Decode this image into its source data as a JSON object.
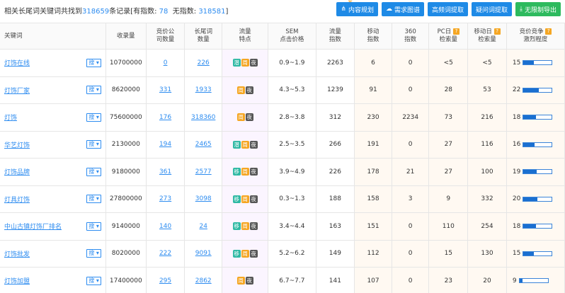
{
  "summary": {
    "prefix": "相关长尾词关键词共找到",
    "total": "318659",
    "suffix": "条记录[有指数:",
    "with_index": "78",
    "no_index_label": "无指数:",
    "no_index": "318581",
    "end": "]"
  },
  "actions": [
    {
      "label": "内容规划",
      "icon": "share-icon"
    },
    {
      "label": "需求图谱",
      "icon": "cloud-icon"
    },
    {
      "label": "高频词提取",
      "icon": ""
    },
    {
      "label": "疑问词提取",
      "icon": ""
    },
    {
      "label": "无限制导出",
      "icon": "download-icon"
    }
  ],
  "headers": {
    "keyword": "关键词",
    "indexed": "收录量",
    "bid_companies_1": "竞价公",
    "bid_companies_2": "司数量",
    "longtail_1": "长尾词",
    "longtail_2": "数量",
    "traffic_1": "流量",
    "traffic_2": "特点",
    "sem_1": "SEM",
    "sem_2": "点击价格",
    "flow_1": "流量",
    "flow_2": "指数",
    "mobile_1": "移动",
    "mobile_2": "指数",
    "s360_1": "360",
    "s360_2": "指数",
    "pc_1": "PC日",
    "pc_2": "检索量",
    "mobday_1": "移动日",
    "mobday_2": "检索量",
    "comp_1": "竞价竞争",
    "comp_2": "激烈程度"
  },
  "search_label": "搜",
  "tag_labels": {
    "qian": "潜",
    "zhou": "周",
    "ye": "夜",
    "yi": "移"
  },
  "rows": [
    {
      "keyword": "灯饰在线",
      "indexed": "10700000",
      "bid": "0",
      "longtail": "226",
      "tags": [
        "qian",
        "zhou",
        "ye"
      ],
      "sem": "0.9~1.9",
      "flow": "2263",
      "mobile": "6",
      "s360": "0",
      "pc": "<5",
      "mobday": "<5",
      "comp": "15",
      "comp_pct": 0.38
    },
    {
      "keyword": "灯饰厂家",
      "indexed": "8620000",
      "bid": "331",
      "longtail": "1933",
      "tags": [
        "zhou",
        "ye"
      ],
      "sem": "4.3~5.3",
      "flow": "1239",
      "mobile": "91",
      "s360": "0",
      "pc": "28",
      "mobday": "53",
      "comp": "22",
      "comp_pct": 0.55
    },
    {
      "keyword": "灯饰",
      "indexed": "75600000",
      "bid": "176",
      "longtail": "318360",
      "tags": [
        "zhou",
        "ye"
      ],
      "sem": "2.8~3.8",
      "flow": "312",
      "mobile": "230",
      "s360": "2234",
      "pc": "73",
      "mobday": "216",
      "comp": "18",
      "comp_pct": 0.45
    },
    {
      "keyword": "华艺灯饰",
      "indexed": "2130000",
      "bid": "194",
      "longtail": "2465",
      "tags": [
        "qian",
        "zhou",
        "ye"
      ],
      "sem": "2.5~3.5",
      "flow": "266",
      "mobile": "191",
      "s360": "0",
      "pc": "27",
      "mobday": "116",
      "comp": "16",
      "comp_pct": 0.4
    },
    {
      "keyword": "灯饰品牌",
      "indexed": "9180000",
      "bid": "361",
      "longtail": "2577",
      "tags": [
        "yi",
        "zhou",
        "ye"
      ],
      "sem": "3.9~4.9",
      "flow": "226",
      "mobile": "178",
      "s360": "21",
      "pc": "27",
      "mobday": "100",
      "comp": "19",
      "comp_pct": 0.47
    },
    {
      "keyword": "灯具灯饰",
      "indexed": "27800000",
      "bid": "273",
      "longtail": "3098",
      "tags": [
        "yi",
        "zhou",
        "ye"
      ],
      "sem": "0.3~1.3",
      "flow": "188",
      "mobile": "158",
      "s360": "3",
      "pc": "9",
      "mobday": "332",
      "comp": "20",
      "comp_pct": 0.5
    },
    {
      "keyword": "中山古镇灯饰厂排名",
      "indexed": "9140000",
      "bid": "140",
      "longtail": "24",
      "tags": [
        "yi",
        "zhou",
        "ye"
      ],
      "sem": "3.4~4.4",
      "flow": "163",
      "mobile": "151",
      "s360": "0",
      "pc": "110",
      "mobday": "254",
      "comp": "18",
      "comp_pct": 0.45
    },
    {
      "keyword": "灯饰批发",
      "indexed": "8020000",
      "bid": "222",
      "longtail": "9091",
      "tags": [
        "yi",
        "zhou",
        "ye"
      ],
      "sem": "5.2~6.2",
      "flow": "149",
      "mobile": "112",
      "s360": "0",
      "pc": "15",
      "mobday": "130",
      "comp": "15",
      "comp_pct": 0.38
    },
    {
      "keyword": "灯饰加盟",
      "indexed": "17400000",
      "bid": "295",
      "longtail": "2862",
      "tags": [
        "zhou",
        "ye"
      ],
      "sem": "6.7~7.7",
      "flow": "141",
      "mobile": "107",
      "s360": "0",
      "pc": "23",
      "mobday": "20",
      "comp": "9",
      "comp_pct": 0.12
    }
  ]
}
